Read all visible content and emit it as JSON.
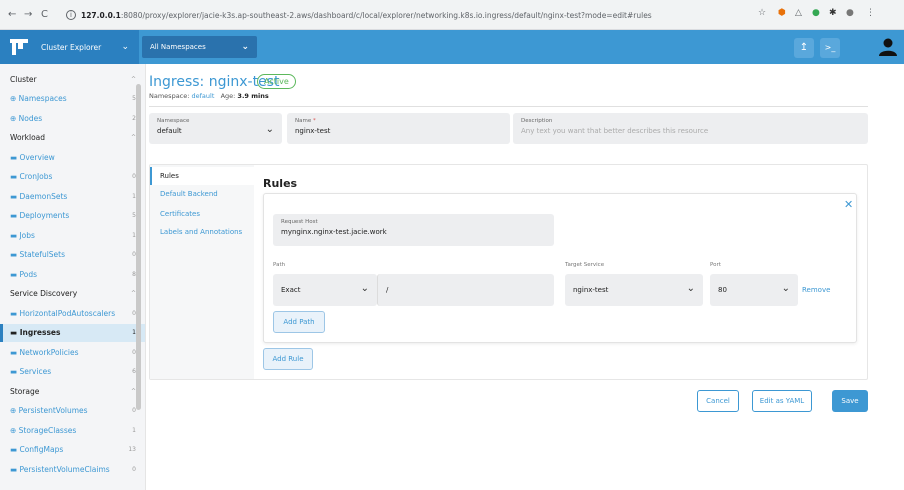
{
  "browser": {
    "back": "←",
    "forward": "→",
    "reload": "C",
    "url_host": "127.0.0.1",
    "url_rest": ":8080/proxy/explorer/jacie-k3s.ap-southeast-2.aws/dashboard/c/local/explorer/networking.k8s.io.ingress/default/nginx-test?mode=edit#rules"
  },
  "header": {
    "app_title": "Cluster Explorer",
    "namespace_filter": "All Namespaces"
  },
  "sidebar": {
    "items": [
      {
        "label": "Cluster",
        "count": "^",
        "type": "group"
      },
      {
        "label": "⊕ Namespaces",
        "count": "5",
        "type": "item"
      },
      {
        "label": "⊕ Nodes",
        "count": "2",
        "type": "item"
      },
      {
        "label": "Workload",
        "count": "^",
        "type": "group"
      },
      {
        "label": "▬ Overview",
        "count": "",
        "type": "item"
      },
      {
        "label": "▬ CronJobs",
        "count": "0",
        "type": "item"
      },
      {
        "label": "▬ DaemonSets",
        "count": "1",
        "type": "item"
      },
      {
        "label": "▬ Deployments",
        "count": "5",
        "type": "item"
      },
      {
        "label": "▬ Jobs",
        "count": "1",
        "type": "item"
      },
      {
        "label": "▬ StatefulSets",
        "count": "0",
        "type": "item"
      },
      {
        "label": "▬ Pods",
        "count": "8",
        "type": "item"
      },
      {
        "label": "Service Discovery",
        "count": "^",
        "type": "group"
      },
      {
        "label": "▬ HorizontalPodAutoscalers",
        "count": "0",
        "type": "item"
      },
      {
        "label": "▬ Ingresses",
        "count": "1",
        "type": "active"
      },
      {
        "label": "▬ NetworkPolicies",
        "count": "0",
        "type": "item"
      },
      {
        "label": "▬ Services",
        "count": "6",
        "type": "item"
      },
      {
        "label": "Storage",
        "count": "^",
        "type": "group"
      },
      {
        "label": "⊕ PersistentVolumes",
        "count": "0",
        "type": "item"
      },
      {
        "label": "⊕ StorageClasses",
        "count": "1",
        "type": "item"
      },
      {
        "label": "▬ ConfigMaps",
        "count": "13",
        "type": "item"
      },
      {
        "label": "▬ PersistentVolumeClaims",
        "count": "0",
        "type": "item"
      }
    ]
  },
  "page": {
    "title_prefix": "Ingress: ",
    "title_name": "nginx-test",
    "status": "Active",
    "namespace_label": "Namespace: ",
    "namespace_value": "default",
    "age_label": "Age: ",
    "age_value": "3.9 mins"
  },
  "form": {
    "namespace": {
      "label": "Namespace",
      "value": "default"
    },
    "name": {
      "label": "Name",
      "required_mark": "*",
      "value": "nginx-test"
    },
    "description": {
      "label": "Description",
      "placeholder": "Any text you want that better describes this resource"
    }
  },
  "tabs": [
    "Rules",
    "Default Backend",
    "Certificates",
    "Labels and Annotations"
  ],
  "rules": {
    "heading": "Rules",
    "request_host_label": "Request Host",
    "request_host_value": "mynginx.nginx-test.jacie.work",
    "path_label": "Path",
    "path_type": "Exact",
    "path_value": "/",
    "target_service_label": "Target Service",
    "target_service_value": "nginx-test",
    "port_label": "Port",
    "port_value": "80",
    "remove": "Remove",
    "add_path": "Add Path",
    "add_rule": "Add Rule"
  },
  "footer": {
    "cancel": "Cancel",
    "edit_yaml": "Edit as YAML",
    "save": "Save"
  },
  "colors": {
    "accent": "#3d98d3",
    "brand": "#2b80c0",
    "active_status": "#5cb85c"
  }
}
